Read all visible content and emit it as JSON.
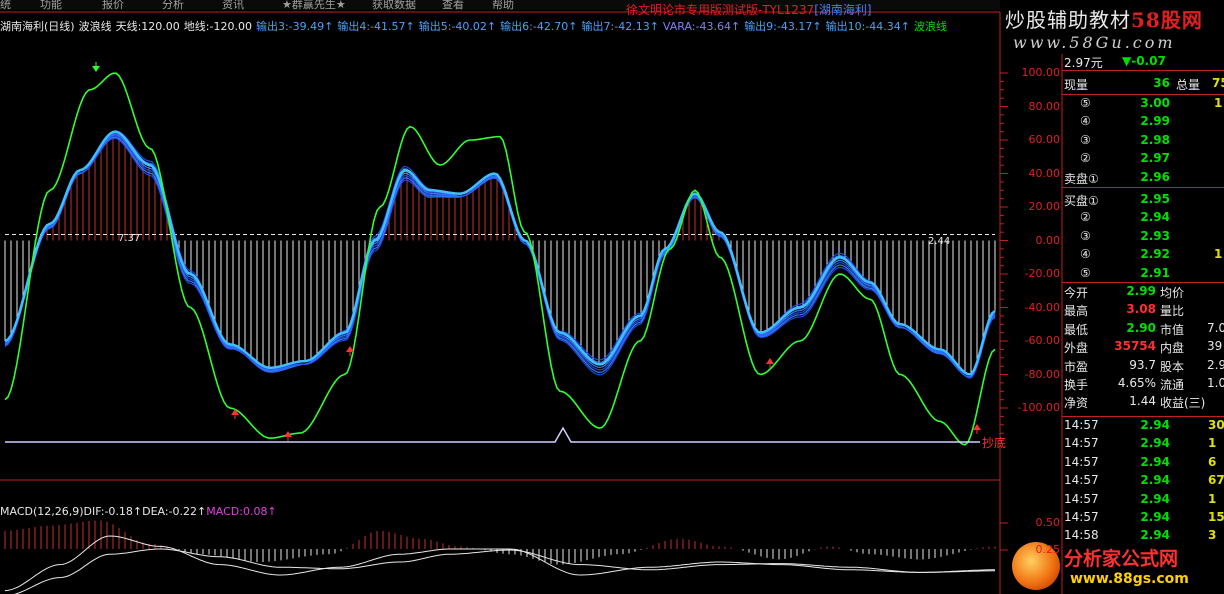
{
  "menu": [
    "统",
    "功能",
    "报价",
    "分析",
    "资讯",
    "★群赢先生★",
    "获取数据",
    "查看",
    "帮助"
  ],
  "title": {
    "main": "徐文明论市专用版测试版-TYL1237",
    "tag": "[湖南海利]"
  },
  "watermark": {
    "top": [
      "炒股辅助教材",
      "58股网"
    ],
    "url": "www.58Gu.com",
    "bottom_name": "分析家公式网",
    "bottom_url": "www.88gs.com"
  },
  "indicator_legend": [
    {
      "text": "湖南海利(日线)",
      "color": "#e8e8e8"
    },
    {
      "text": "波浪线",
      "color": "#e8e8e8"
    },
    {
      "text": "天线:120.00",
      "color": "#e8e8e8"
    },
    {
      "text": "地线:-120.00",
      "color": "#e8e8e8"
    },
    {
      "text": "输出3:-39.49↑",
      "color": "#4aa0ff"
    },
    {
      "text": "输出4:-41.57↑",
      "color": "#4aa0ff"
    },
    {
      "text": "输出5:-40.02↑",
      "color": "#4aa0ff"
    },
    {
      "text": "输出6:-42.70↑",
      "color": "#4aa0ff"
    },
    {
      "text": "输出7:-42.13↑",
      "color": "#4aa0ff"
    },
    {
      "text": "VARA:-43.64↑",
      "color": "#8080ff"
    },
    {
      "text": "输出9:-43.17↑",
      "color": "#4aa0ff"
    },
    {
      "text": "输出10:-44.34↑",
      "color": "#4aa0ff"
    },
    {
      "text": "波浪线",
      "color": "#00e000"
    }
  ],
  "axis": {
    "main_ticks": [
      "100.00",
      "80.00",
      "60.00",
      "40.00",
      "20.00",
      "0.00",
      "-20.00",
      "-40.00",
      "-60.00",
      "-80.00",
      "-100.00"
    ],
    "macd_ticks": [
      "0.50",
      "0.25"
    ]
  },
  "annotations": {
    "mid_value": "7.37",
    "right_value": "2.44",
    "bottom_label": "抄底"
  },
  "macd_legend": [
    {
      "text": "MACD(12,26,9)",
      "color": "#e8e8e8"
    },
    {
      "text": "DIF:-0.18↑",
      "color": "#e8e8e8"
    },
    {
      "text": "DEA:-0.22↑",
      "color": "#e8e8e8"
    },
    {
      "text": "MACD:0.08↑",
      "color": "#e040e0"
    }
  ],
  "quote": {
    "price_row": {
      "price": "2.97元",
      "change": "▼-0.07"
    },
    "volume_row": {
      "label1": "现量",
      "v1": "36",
      "label2": "总量",
      "v2": "75"
    },
    "asks": [
      {
        "label": "⑤",
        "price": "3.00",
        "qty": "1"
      },
      {
        "label": "④",
        "price": "2.99",
        "qty": ""
      },
      {
        "label": "③",
        "price": "2.98",
        "qty": ""
      },
      {
        "label": "②",
        "price": "2.97",
        "qty": ""
      },
      {
        "label": "卖盘①",
        "price": "2.96",
        "qty": ""
      }
    ],
    "bids": [
      {
        "label": "买盘①",
        "price": "2.95",
        "qty": ""
      },
      {
        "label": "②",
        "price": "2.94",
        "qty": ""
      },
      {
        "label": "③",
        "price": "2.93",
        "qty": ""
      },
      {
        "label": "④",
        "price": "2.92",
        "qty": "1"
      },
      {
        "label": "⑤",
        "price": "2.91",
        "qty": ""
      }
    ],
    "stats": [
      {
        "l1": "今开",
        "v1": "2.99",
        "c1": "g",
        "l2": "均价",
        "v2": ""
      },
      {
        "l1": "最高",
        "v1": "3.08",
        "c1": "r",
        "l2": "量比",
        "v2": ""
      },
      {
        "l1": "最低",
        "v1": "2.90",
        "c1": "g",
        "l2": "市值",
        "v2": "7.0"
      },
      {
        "l1": "外盘",
        "v1": "35754",
        "c1": "r",
        "l2": "内盘",
        "v2": "39"
      },
      {
        "l1": "市盈",
        "v1": "93.7",
        "c1": "w",
        "l2": "股本",
        "v2": "2.9"
      },
      {
        "l1": "换手",
        "v1": "4.65%",
        "c1": "w",
        "l2": "流通",
        "v2": "1.0"
      },
      {
        "l1": "净资",
        "v1": "1.44",
        "c1": "w",
        "l2": "收益(三)",
        "v2": ""
      }
    ],
    "ticks": [
      {
        "time": "14:57",
        "price": "2.94",
        "vol": "30"
      },
      {
        "time": "14:57",
        "price": "2.94",
        "vol": "1"
      },
      {
        "time": "14:57",
        "price": "2.94",
        "vol": "6"
      },
      {
        "time": "14:57",
        "price": "2.94",
        "vol": "67"
      },
      {
        "time": "14:57",
        "price": "2.94",
        "vol": "1"
      },
      {
        "time": "14:57",
        "price": "2.94",
        "vol": "15"
      },
      {
        "time": "14:58",
        "price": "2.94",
        "vol": "3"
      }
    ]
  },
  "colors": {
    "wave_upper": "#30ff30",
    "wave_lower": "#30ff30",
    "fan": "#3070ff",
    "up_bar": "#c03030",
    "down_bar": "#e8e8e8",
    "axis": "#e02020"
  }
}
